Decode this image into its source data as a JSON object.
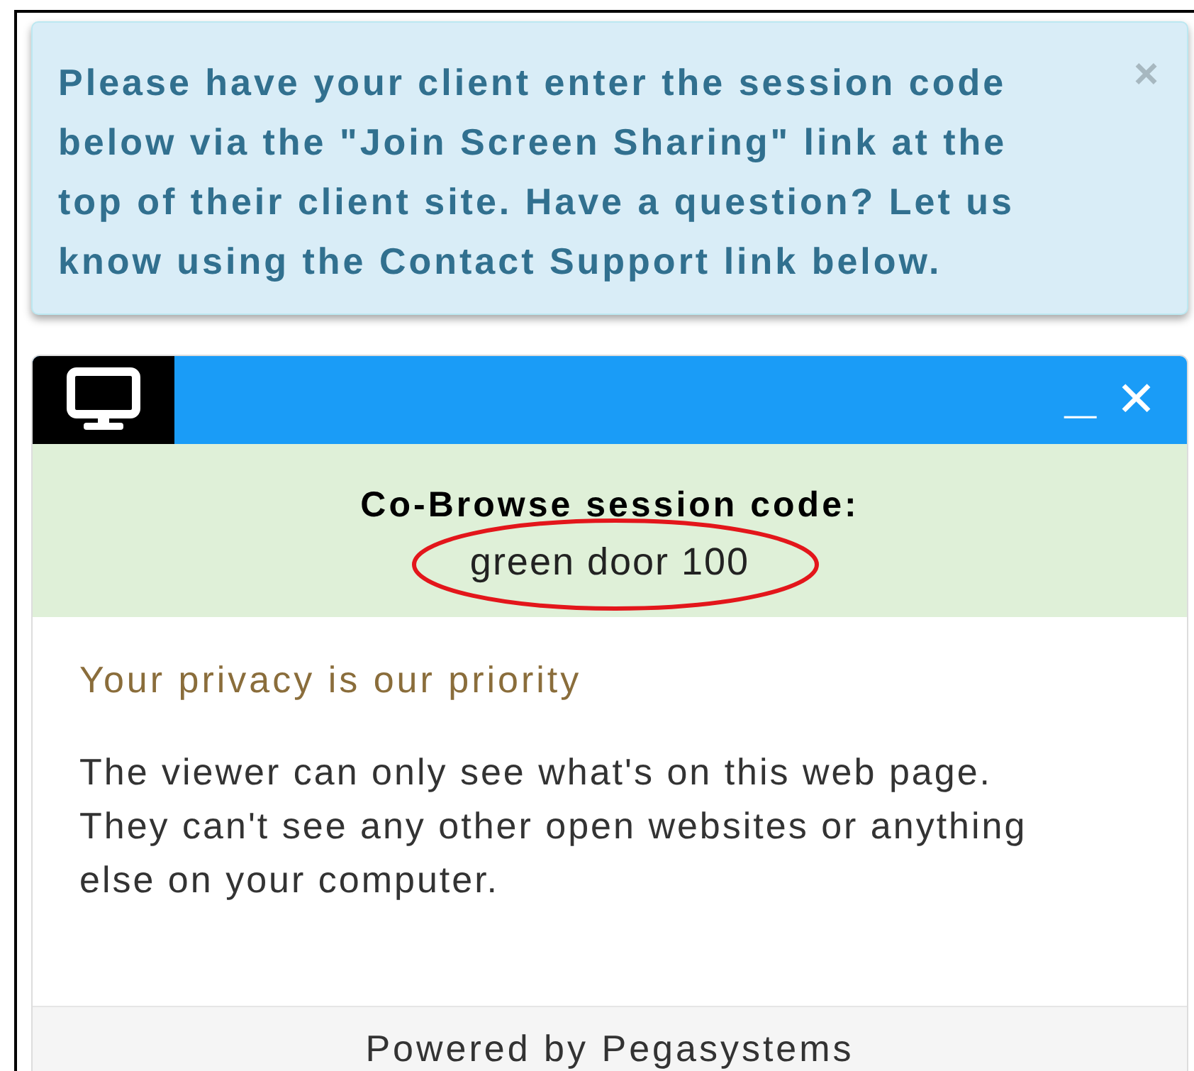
{
  "alert": {
    "message": "Please have your client enter the session code below via the \"Join Screen Sharing\" link at the top of their client site. Have a question? Let us know using the Contact Support link below.",
    "close": "×"
  },
  "panel": {
    "minimize": "_",
    "close": "✕",
    "session": {
      "title": "Co-Browse session code:",
      "code": "green door 100",
      "circled": true
    },
    "privacy_heading": "Your privacy is our priority",
    "privacy_text": "The viewer can only see what's on this web page. They can't see any other open websites or anything else on your computer.",
    "footer": "Powered by Pegasystems"
  }
}
